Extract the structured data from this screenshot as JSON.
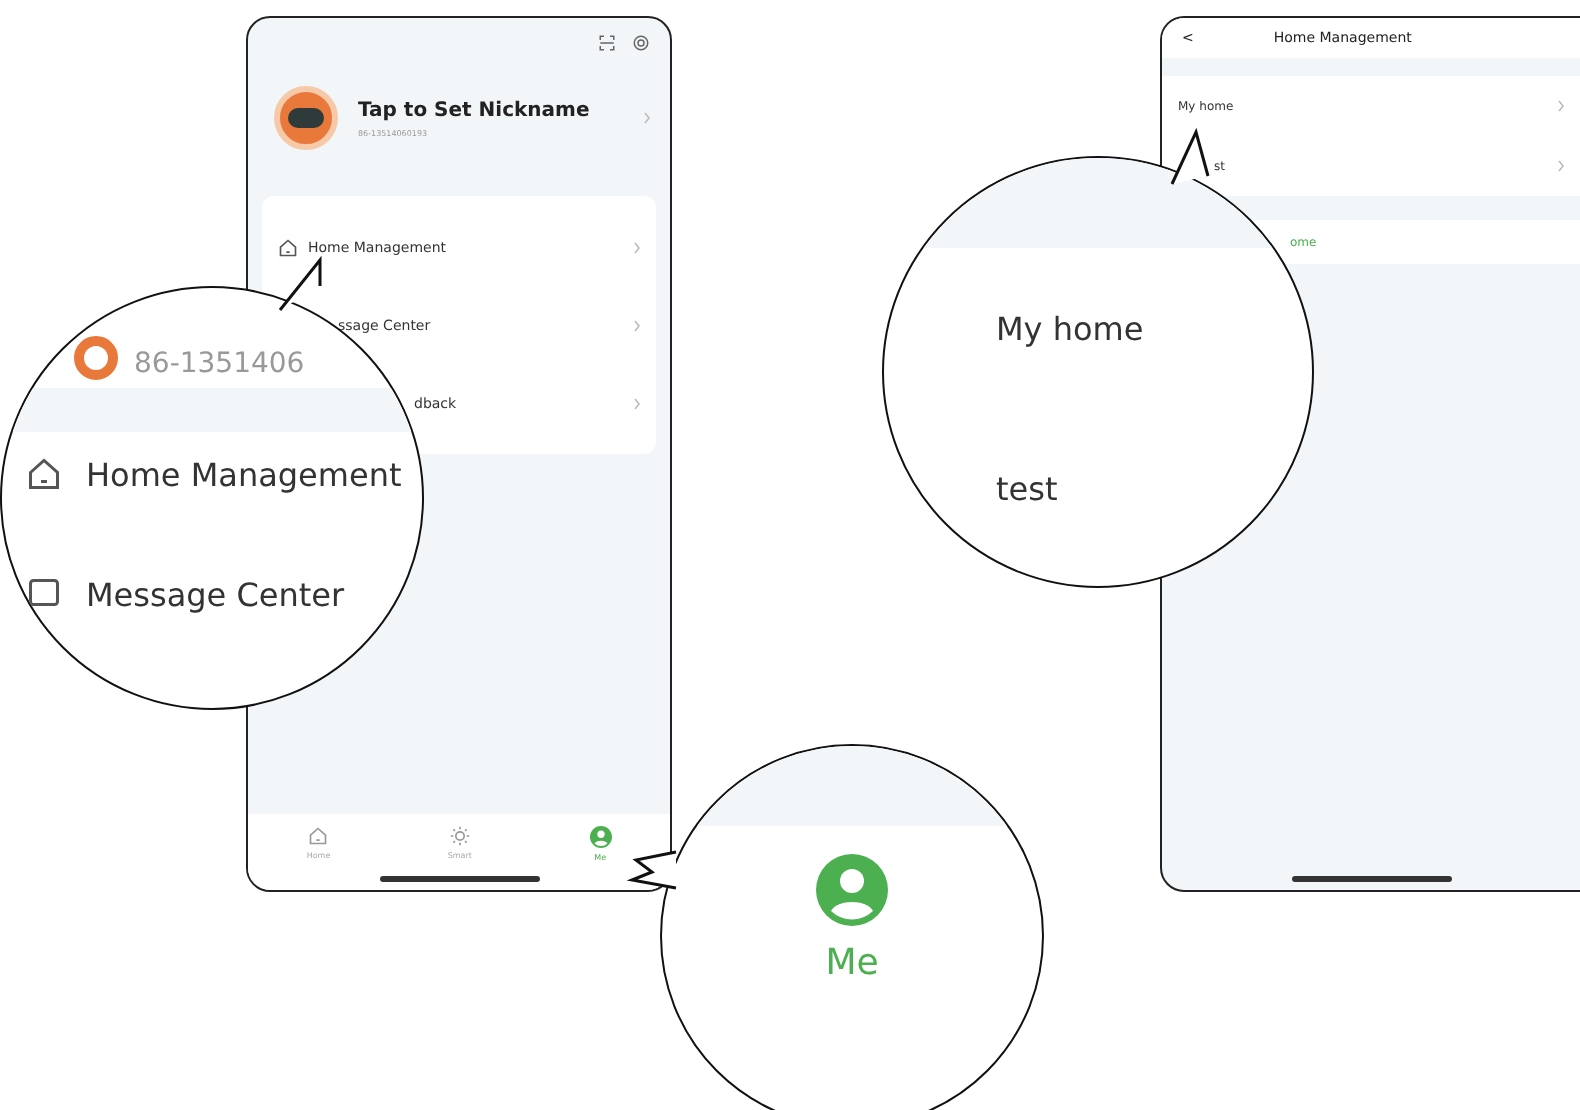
{
  "profile_screen": {
    "nickname": "Tap to Set Nickname",
    "phone": "86-13514060193",
    "menu": [
      {
        "label": "Home Management"
      },
      {
        "label": "ssage Center"
      },
      {
        "label": "dback"
      }
    ],
    "tabs": [
      {
        "label": "Home",
        "selected": false
      },
      {
        "label": "Smart",
        "selected": false
      },
      {
        "label": "Me",
        "selected": true
      }
    ]
  },
  "home_screen": {
    "title": "Home Management",
    "back": "<",
    "homes": [
      {
        "label": "My home"
      },
      {
        "label": "st"
      }
    ],
    "action": "ome"
  },
  "callouts": [
    {
      "kind": "profile",
      "phone": "86-1351406",
      "items": [
        "Home Management",
        "Message Center"
      ]
    },
    {
      "kind": "tab",
      "label": "Me",
      "selected": true
    },
    {
      "kind": "homes",
      "items": [
        "My home",
        "test"
      ]
    }
  ]
}
